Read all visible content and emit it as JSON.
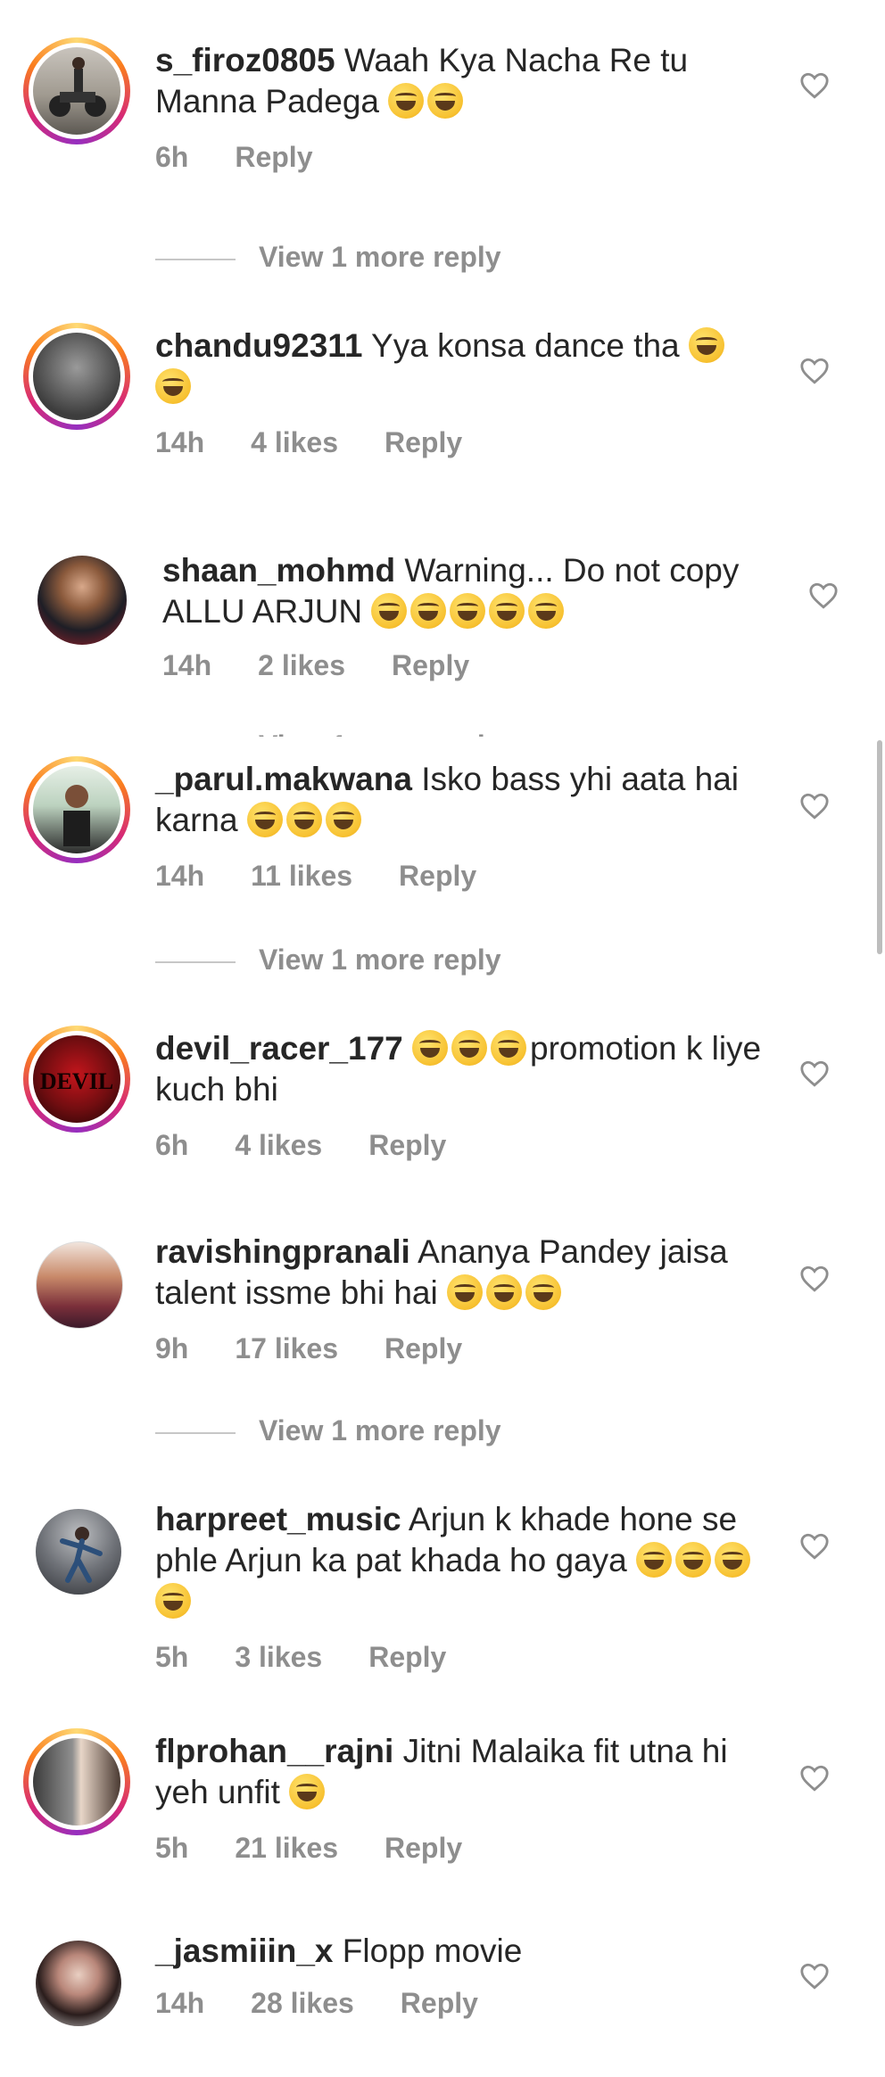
{
  "emoji_names": [
    "laughing-emoji",
    "rofl-emoji"
  ],
  "comments": [
    {
      "username": "s_firoz0805",
      "text": "Waah Kya Nacha Re tu Manna Padega",
      "time": "6h",
      "likes": "",
      "reply": "Reply",
      "emojis": 2,
      "avatar": "avatar-biker"
    },
    {
      "username": "chandu92311",
      "text": "Yya konsa dance tha",
      "time": "14h",
      "likes": "4 likes",
      "reply": "Reply",
      "emojis": 2,
      "avatar": "avatar-man"
    },
    {
      "username": "shaan_mohmd",
      "text": "Warning... Do not copy ALLU ARJUN",
      "time": "14h",
      "likes": "2 likes",
      "reply": "Reply",
      "emojis": 5,
      "avatar": "avatar-man"
    },
    {
      "username": "_parul.makwana",
      "text": "Isko bass yhi aata hai karna",
      "time": "14h",
      "likes": "11 likes",
      "reply": "Reply",
      "emojis": 3,
      "avatar": "avatar-woman"
    },
    {
      "username": "devil_racer_177",
      "text": "promotion k liye kuch bhi",
      "time": "6h",
      "likes": "4 likes",
      "reply": "Reply",
      "emojis": 3,
      "avatar": "avatar-devil"
    },
    {
      "username": "ravishingpranali",
      "text": "Ananya Pandey jaisa talent issme bhi hai",
      "time": "9h",
      "likes": "17 likes",
      "reply": "Reply",
      "emojis": 3,
      "avatar": "avatar-woman"
    },
    {
      "username": "harpreet_music",
      "text": "Arjun k khade hone se phle Arjun ka pat khada ho gaya",
      "time": "5h",
      "likes": "3 likes",
      "reply": "Reply",
      "emojis": 4,
      "avatar": "avatar-dancer"
    },
    {
      "username": "flprohan__rajni",
      "text": "Jitni Malaika fit utna hi yeh unfit",
      "time": "5h",
      "likes": "21 likes",
      "reply": "Reply",
      "emojis": 1,
      "avatar": "avatar-couple"
    },
    {
      "username": "_jasmiiin_x",
      "text": "Flopp movie",
      "time": "14h",
      "likes": "28 likes",
      "reply": "Reply",
      "emojis": 0,
      "avatar": "avatar-woman"
    }
  ],
  "view_more": "View 1 more reply",
  "cutoff_text": "View 1 more reply"
}
